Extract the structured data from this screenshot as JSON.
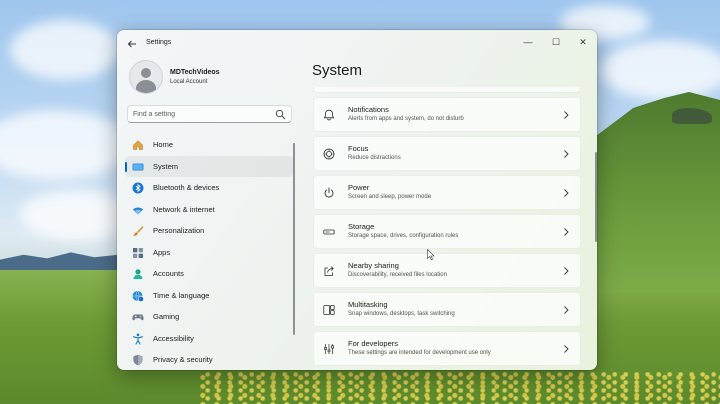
{
  "window": {
    "title": "Settings",
    "controls": {
      "minimize": "—",
      "maximize": "☐",
      "close": "✕"
    }
  },
  "profile": {
    "name": "MDTechVideos",
    "account_type": "Local Account"
  },
  "search": {
    "placeholder": "Find a setting"
  },
  "sidebar": {
    "items": [
      {
        "label": "Home",
        "icon": "home-icon"
      },
      {
        "label": "System",
        "icon": "system-icon",
        "active": true
      },
      {
        "label": "Bluetooth & devices",
        "icon": "bluetooth-icon"
      },
      {
        "label": "Network & internet",
        "icon": "wifi-icon"
      },
      {
        "label": "Personalization",
        "icon": "brush-icon"
      },
      {
        "label": "Apps",
        "icon": "apps-icon"
      },
      {
        "label": "Accounts",
        "icon": "accounts-icon"
      },
      {
        "label": "Time & language",
        "icon": "globe-clock-icon"
      },
      {
        "label": "Gaming",
        "icon": "gamepad-icon"
      },
      {
        "label": "Accessibility",
        "icon": "accessibility-icon"
      },
      {
        "label": "Privacy & security",
        "icon": "shield-icon"
      }
    ]
  },
  "main": {
    "title": "System",
    "cards": [
      {
        "title": "Notifications",
        "subtitle": "Alerts from apps and system, do not disturb",
        "icon": "bell-icon"
      },
      {
        "title": "Focus",
        "subtitle": "Reduce distractions",
        "icon": "focus-icon"
      },
      {
        "title": "Power",
        "subtitle": "Screen and sleep, power mode",
        "icon": "power-icon"
      },
      {
        "title": "Storage",
        "subtitle": "Storage space, drives, configuration rules",
        "icon": "storage-icon"
      },
      {
        "title": "Nearby sharing",
        "subtitle": "Discoverability, received files location",
        "icon": "share-icon"
      },
      {
        "title": "Multitasking",
        "subtitle": "Snap windows, desktops, task switching",
        "icon": "multitasking-icon"
      },
      {
        "title": "For developers",
        "subtitle": "These settings are intended for development use only",
        "icon": "developer-tools-icon"
      }
    ]
  },
  "colors": {
    "accent": "#0067c0"
  }
}
